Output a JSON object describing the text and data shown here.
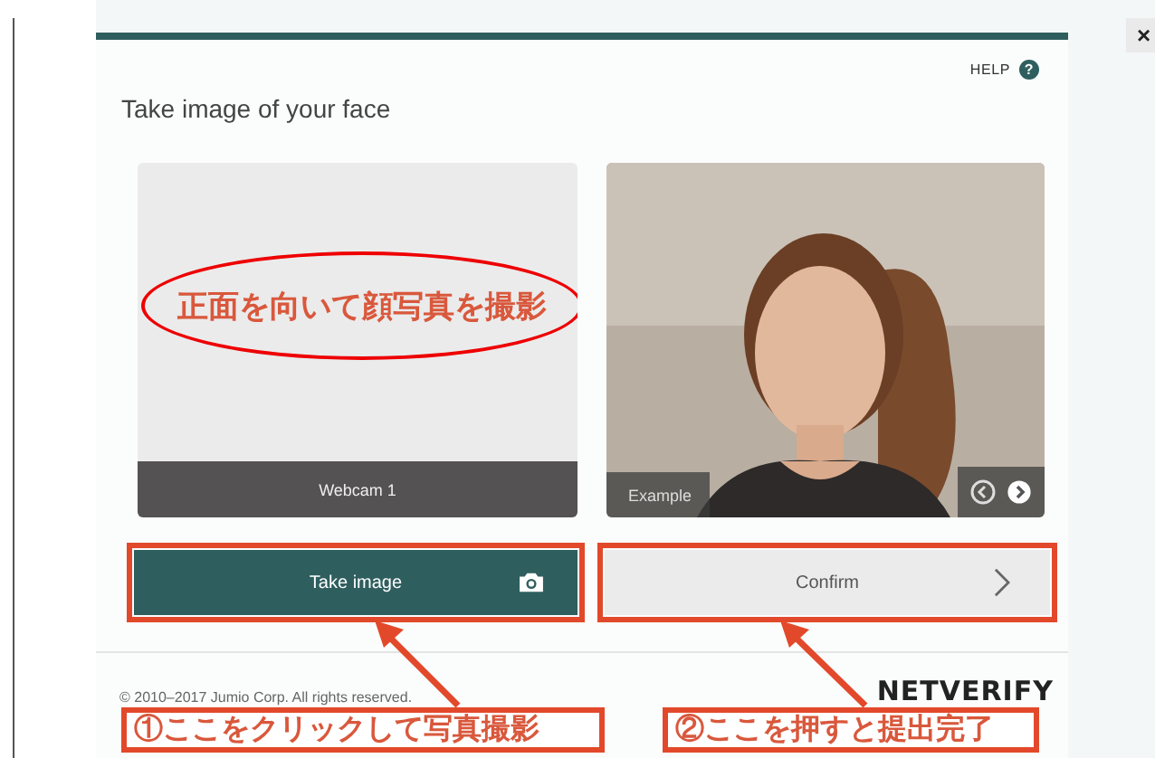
{
  "close_button": "×",
  "help": {
    "label": "HELP",
    "icon": "?"
  },
  "title": "Take image of your face",
  "webcam_panel": {
    "caption": "Webcam 1",
    "note": "正面を向いて顔写真を撮影"
  },
  "example_panel": {
    "kind": "picture",
    "caption": "Example"
  },
  "buttons": [
    {
      "label": "Take image",
      "kind": "primary"
    },
    {
      "label": "Confirm",
      "kind": "secondary"
    }
  ],
  "footer": {
    "copyright": "© 2010–2017 Jumio Corp. All rights reserved.",
    "logo": "NETVERIFY"
  },
  "annotations": [
    "①ここをクリックして写真撮影",
    "②ここを押すと提出完了"
  ]
}
